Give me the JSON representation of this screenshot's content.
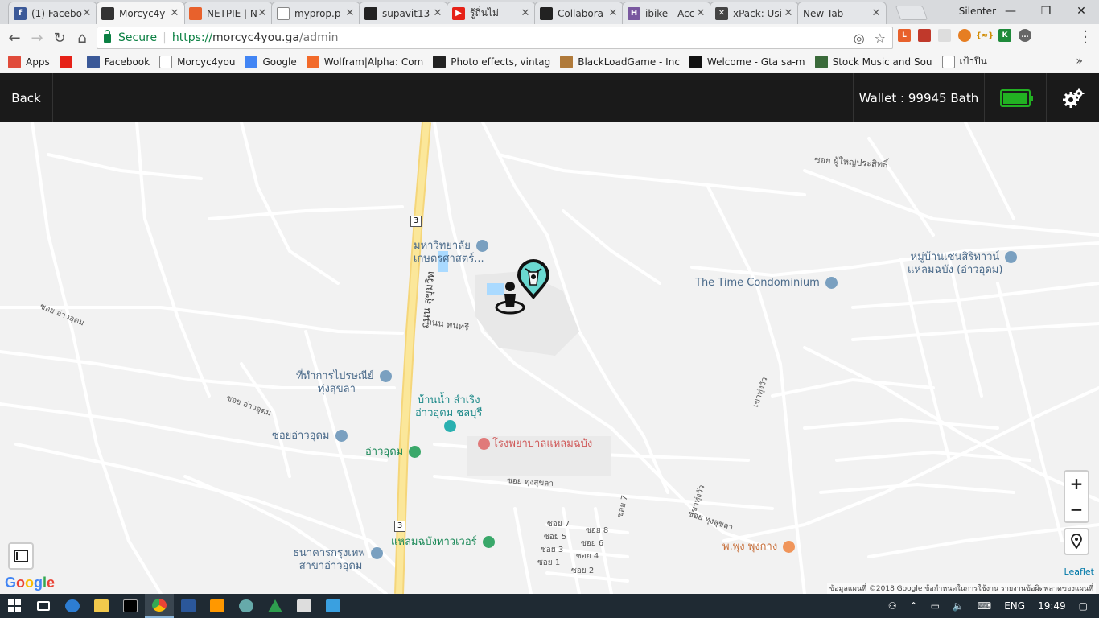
{
  "browser": {
    "tabs": [
      {
        "title": "(1) Facebo",
        "favicon": "facebook-icon",
        "color": "#3b5998",
        "glyph": "f",
        "active": false
      },
      {
        "title": "Morcyc4y",
        "favicon": "motorcycle-icon",
        "color": "#333333",
        "glyph": "",
        "active": true
      },
      {
        "title": "NETPIE | N",
        "favicon": "netpie-icon",
        "color": "#e8612c",
        "glyph": "",
        "active": false
      },
      {
        "title": "myprop.p",
        "favicon": "document-icon",
        "color": "#ffffff",
        "glyph": "",
        "active": false
      },
      {
        "title": "supavit13",
        "favicon": "github-icon",
        "color": "#222222",
        "glyph": "",
        "active": false
      },
      {
        "title": "รู้ถิ่นไม่",
        "favicon": "youtube-icon",
        "color": "#e62117",
        "glyph": "▶",
        "active": false
      },
      {
        "title": "Collabora",
        "favicon": "github-icon",
        "color": "#222222",
        "glyph": "",
        "active": false
      },
      {
        "title": "ibike - Acc",
        "favicon": "heroku-icon",
        "color": "#79589f",
        "glyph": "H",
        "active": false
      },
      {
        "title": "xPack: Usi",
        "favicon": "xpack-icon",
        "color": "#444444",
        "glyph": "✕",
        "active": false
      },
      {
        "title": "New Tab",
        "favicon": "",
        "color": "",
        "glyph": "",
        "active": false
      }
    ],
    "user": "Silenter",
    "secure_label": "Secure",
    "url_scheme": "https://",
    "url_host": "morcyc4you.ga",
    "url_path": "/admin",
    "bookmarks": [
      {
        "label": "Apps",
        "icon": "apps-grid-icon",
        "color": "#e04b3a"
      },
      {
        "label": "",
        "icon": "youtube-icon",
        "color": "#e62117"
      },
      {
        "label": "Facebook",
        "icon": "facebook-icon",
        "color": "#3b5998"
      },
      {
        "label": "Morcyc4you",
        "icon": "document-icon",
        "color": "#ffffff"
      },
      {
        "label": "Google",
        "icon": "google-icon",
        "color": "#4285f4"
      },
      {
        "label": "Wolfram|Alpha: Com",
        "icon": "wolfram-icon",
        "color": "#f26a2a"
      },
      {
        "label": "Photo effects, vintag",
        "icon": "star-icon",
        "color": "#222222"
      },
      {
        "label": "BlackLoadGame - Inc",
        "icon": "game-icon",
        "color": "#b07a3a"
      },
      {
        "label": "Welcome - Gta sa-m",
        "icon": "w-icon",
        "color": "#111111"
      },
      {
        "label": "Stock Music and Sou",
        "icon": "bars-icon",
        "color": "#3a6a3a"
      },
      {
        "label": "เป้าปีน",
        "icon": "document-icon",
        "color": "#ffffff"
      }
    ]
  },
  "app": {
    "back_label": "Back",
    "wallet_label": "Wallet : 99945 Bath",
    "battery_level": 1.0,
    "accent_color": "#22b022"
  },
  "map": {
    "road_labels": [
      {
        "text": "ถนน สุขุมวิท",
        "rot": -84
      },
      {
        "text": "ถนน พนทรี",
        "rot": 8
      },
      {
        "text": "ซอย ผู้ใหญ่ประสิทธิ์",
        "rot": 4
      },
      {
        "text": "ซอย ทุ่งสุขลา",
        "rot": 4
      },
      {
        "text": "ซอย อ่าวอุดม",
        "rot": 20
      },
      {
        "text": "ซอย อ่าวอุดม",
        "rot": 22
      },
      {
        "text": "เขาทุ่งวัว",
        "rot": -72
      },
      {
        "text": "เขาทุ่งวัว",
        "rot": -72
      },
      {
        "text": "ซอย ทุ่งสุขลา",
        "rot": 18
      },
      {
        "text": "ซอย 7",
        "rot": -76
      },
      {
        "text": "ซอย 7",
        "rot": 0
      },
      {
        "text": "ซอย 5",
        "rot": 0
      },
      {
        "text": "ซอย 3",
        "rot": 0
      },
      {
        "text": "ซอย 1",
        "rot": 0
      },
      {
        "text": "ซอย 8",
        "rot": 0
      },
      {
        "text": "ซอย 6",
        "rot": 0
      },
      {
        "text": "ซอย 4",
        "rot": 0
      },
      {
        "text": "ซอย 2",
        "rot": 0
      }
    ],
    "highway_shield": "3",
    "pois": [
      {
        "line1": "มหาวิทยาลัย",
        "line2": "เกษตรศาสตร์...",
        "color": "#4a6a8a",
        "icon": "university-icon"
      },
      {
        "line1": "หมู่บ้านเซนสิริทาวน์",
        "line2": "แหลมฉบัง (อ่าวอุดม)",
        "color": "#4a6a8a",
        "icon": "place-icon"
      },
      {
        "line1": "The Time Condominium",
        "line2": "",
        "color": "#4a6a8a",
        "icon": "place-icon"
      },
      {
        "line1": "ที่ทำการไปรษณีย์",
        "line2": "ทุ่งสุขลา",
        "color": "#4a6a8a",
        "icon": "mail-icon"
      },
      {
        "line1": "บ้านน้ำ สำเริง",
        "line2": "อ่าวอุดม ชลบุรี",
        "color": "#1e8a8a",
        "icon": "clinic-icon"
      },
      {
        "line1": "โรงพยาบาลแหลมฉบัง",
        "line2": "",
        "color": "#d05a5a",
        "icon": "hospital-icon"
      },
      {
        "line1": "ซอยอ่าวอุดม",
        "line2": "",
        "color": "#4a6a8a",
        "icon": "place-icon"
      },
      {
        "line1": "อ่าวอุดม",
        "line2": "",
        "color": "#1e8a5a",
        "icon": "park-icon"
      },
      {
        "line1": "แหลมฉบังทาวเวอร์",
        "line2": "",
        "color": "#1e8a5a",
        "icon": "place-icon"
      },
      {
        "line1": "ธนาคารกรุงเทพ",
        "line2": "สาขาอ่าวอุดม",
        "color": "#4a6a8a",
        "icon": "bank-icon"
      },
      {
        "line1": "พ.พุง พุงกาง",
        "line2": "",
        "color": "#c86f3a",
        "icon": "restaurant-icon"
      }
    ],
    "zoom_in": "+",
    "zoom_out": "−",
    "google_logo": "Google",
    "leaflet": "Leaflet",
    "attribution": "ข้อมูลแผนที่ ©2018 Google   ข้อกำหนดในการใช้งาน   รายงานข้อผิดพลาดของแผนที่"
  },
  "taskbar": {
    "lang": "ENG",
    "time": "19:49"
  }
}
